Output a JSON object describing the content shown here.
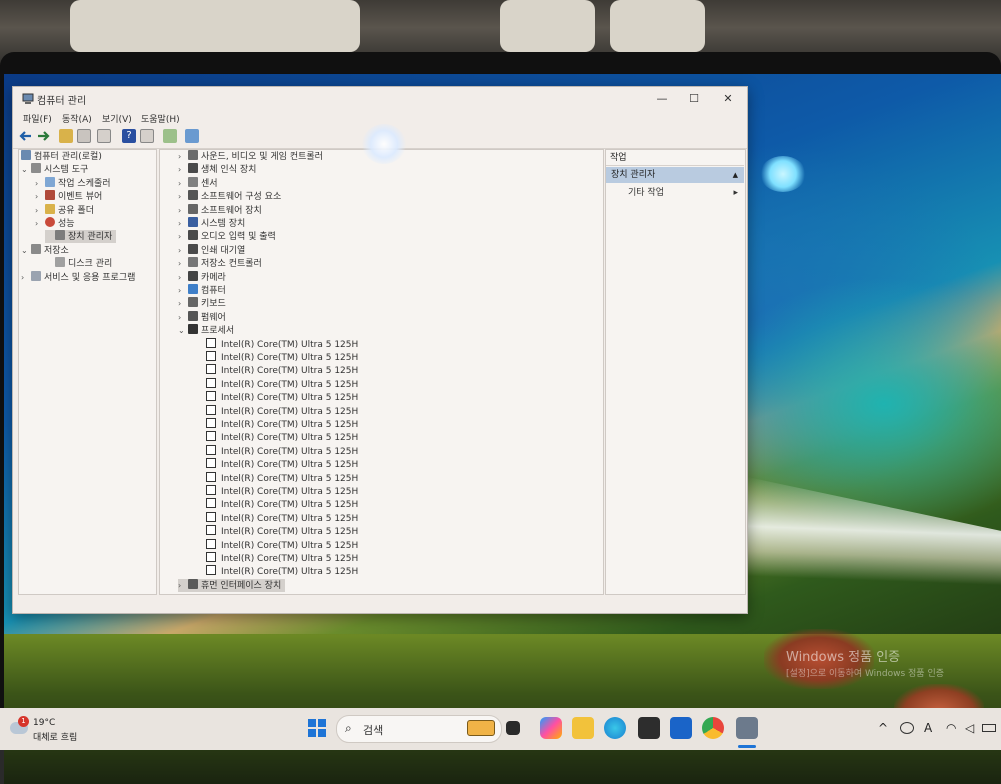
{
  "window": {
    "title": "컴퓨터 관리",
    "controls": {
      "minimize": "—",
      "maximize": "☐",
      "close": "✕"
    }
  },
  "menu": [
    "파일(F)",
    "동작(A)",
    "보기(V)",
    "도움말(H)"
  ],
  "left_tree": [
    {
      "label": "컴퓨터 관리(로컬)",
      "level": 0,
      "expander": ""
    },
    {
      "label": "시스템 도구",
      "level": 1,
      "expander": "⌄"
    },
    {
      "label": "작업 스케줄러",
      "level": 2,
      "expander": "›"
    },
    {
      "label": "이벤트 뷰어",
      "level": 2,
      "expander": "›"
    },
    {
      "label": "공유 폴더",
      "level": 2,
      "expander": "›"
    },
    {
      "label": "성능",
      "level": 2,
      "expander": "›"
    },
    {
      "label": "장치 관리자",
      "level": 2,
      "expander": "",
      "selected": true
    },
    {
      "label": "저장소",
      "level": 1,
      "expander": "⌄"
    },
    {
      "label": "디스크 관리",
      "level": 2,
      "expander": ""
    },
    {
      "label": "서비스 및 응용 프로그램",
      "level": 1,
      "expander": "›"
    }
  ],
  "device_tree": [
    {
      "label": "사운드, 비디오 및 게임 컨트롤러",
      "expander": "›"
    },
    {
      "label": "생체 인식 장치",
      "expander": "›"
    },
    {
      "label": "센서",
      "expander": "›"
    },
    {
      "label": "소프트웨어 구성 요소",
      "expander": "›"
    },
    {
      "label": "소프트웨어 장치",
      "expander": "›"
    },
    {
      "label": "시스템 장치",
      "expander": "›"
    },
    {
      "label": "오디오 입력 및 출력",
      "expander": "›"
    },
    {
      "label": "인쇄 대기열",
      "expander": "›"
    },
    {
      "label": "저장소 컨트롤러",
      "expander": "›"
    },
    {
      "label": "카메라",
      "expander": "›"
    },
    {
      "label": "컴퓨터",
      "expander": "›"
    },
    {
      "label": "키보드",
      "expander": "›"
    },
    {
      "label": "펌웨어",
      "expander": "›"
    },
    {
      "label": "프로세서",
      "expander": "⌄"
    }
  ],
  "processors": [
    "Intel(R) Core(TM) Ultra 5 125H",
    "Intel(R) Core(TM) Ultra 5 125H",
    "Intel(R) Core(TM) Ultra 5 125H",
    "Intel(R) Core(TM) Ultra 5 125H",
    "Intel(R) Core(TM) Ultra 5 125H",
    "Intel(R) Core(TM) Ultra 5 125H",
    "Intel(R) Core(TM) Ultra 5 125H",
    "Intel(R) Core(TM) Ultra 5 125H",
    "Intel(R) Core(TM) Ultra 5 125H",
    "Intel(R) Core(TM) Ultra 5 125H",
    "Intel(R) Core(TM) Ultra 5 125H",
    "Intel(R) Core(TM) Ultra 5 125H",
    "Intel(R) Core(TM) Ultra 5 125H",
    "Intel(R) Core(TM) Ultra 5 125H",
    "Intel(R) Core(TM) Ultra 5 125H",
    "Intel(R) Core(TM) Ultra 5 125H",
    "Intel(R) Core(TM) Ultra 5 125H",
    "Intel(R) Core(TM) Ultra 5 125H"
  ],
  "last_device": {
    "label": "휴먼 인터페이스 장치",
    "expander": "›"
  },
  "actions": {
    "header": "작업",
    "item": "장치 관리자",
    "item_arrow": "▲",
    "sub": "기타 작업",
    "sub_arrow": "▸"
  },
  "watermark": {
    "line1": "Windows 정품 인증",
    "line2": "[설정]으로 이동하여 Windows 정품 인증"
  },
  "taskbar": {
    "weather_temp": "19°C",
    "weather_desc": "대체로 흐림",
    "weather_badge": "1",
    "search_placeholder": "검색",
    "ime": "A",
    "chevron": "^"
  },
  "colors": {
    "accent": "#b9cbe0",
    "selection": "#d4d0cc",
    "window_bg": "#f2ede9"
  }
}
